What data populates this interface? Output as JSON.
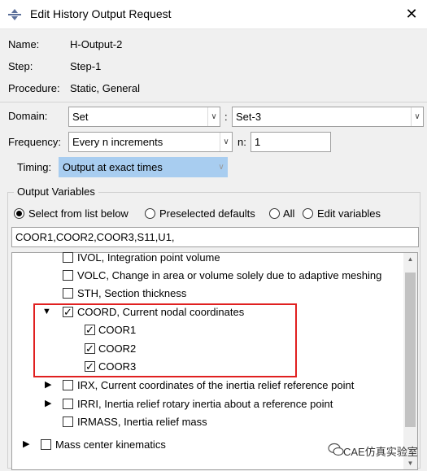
{
  "window": {
    "title": "Edit History Output Request",
    "close_glyph": "✕"
  },
  "info": {
    "name_label": "Name:",
    "name_value": "H-Output-2",
    "step_label": "Step:",
    "step_value": "Step-1",
    "procedure_label": "Procedure:",
    "procedure_value": "Static, General"
  },
  "domain": {
    "label": "Domain:",
    "value": "Set",
    "colon": ":",
    "set_value": "Set-3"
  },
  "frequency": {
    "label": "Frequency:",
    "value": "Every n increments",
    "n_label": "n:",
    "n_value": "1"
  },
  "timing": {
    "label": "Timing:",
    "value": "Output at exact times"
  },
  "output_variables": {
    "group_title": "Output Variables",
    "radios": [
      {
        "label": "Select from list below",
        "selected": true
      },
      {
        "label": "Preselected defaults",
        "selected": false
      },
      {
        "label": "All",
        "selected": false
      },
      {
        "label": "Edit variables",
        "selected": false
      }
    ],
    "variables_text": "COOR1,COOR2,COOR3,S11,U1,",
    "list": [
      {
        "label": "IVOL, Integration point volume",
        "checked": false
      },
      {
        "label": "VOLC, Change in area or volume solely due to adaptive meshing",
        "checked": false
      },
      {
        "label": "STH, Section thickness",
        "checked": false
      },
      {
        "label": "COORD, Current nodal coordinates",
        "checked": true,
        "expanded": true
      },
      {
        "label": "COOR1",
        "checked": true
      },
      {
        "label": "COOR2",
        "checked": true
      },
      {
        "label": "COOR3",
        "checked": true
      },
      {
        "label": "IRX, Current coordinates of the inertia relief reference point",
        "checked": false
      },
      {
        "label": "IRRI, Inertia relief rotary inertia about a reference point",
        "checked": false
      },
      {
        "label": "IRMASS, Inertia relief mass",
        "checked": false
      },
      {
        "label": "Mass center kinematics",
        "checked": false
      }
    ]
  },
  "watermark": {
    "text": "CAE仿真实验室"
  },
  "colors": {
    "highlight_rect": "#e02020",
    "timing_bg": "#a8cdf0"
  }
}
